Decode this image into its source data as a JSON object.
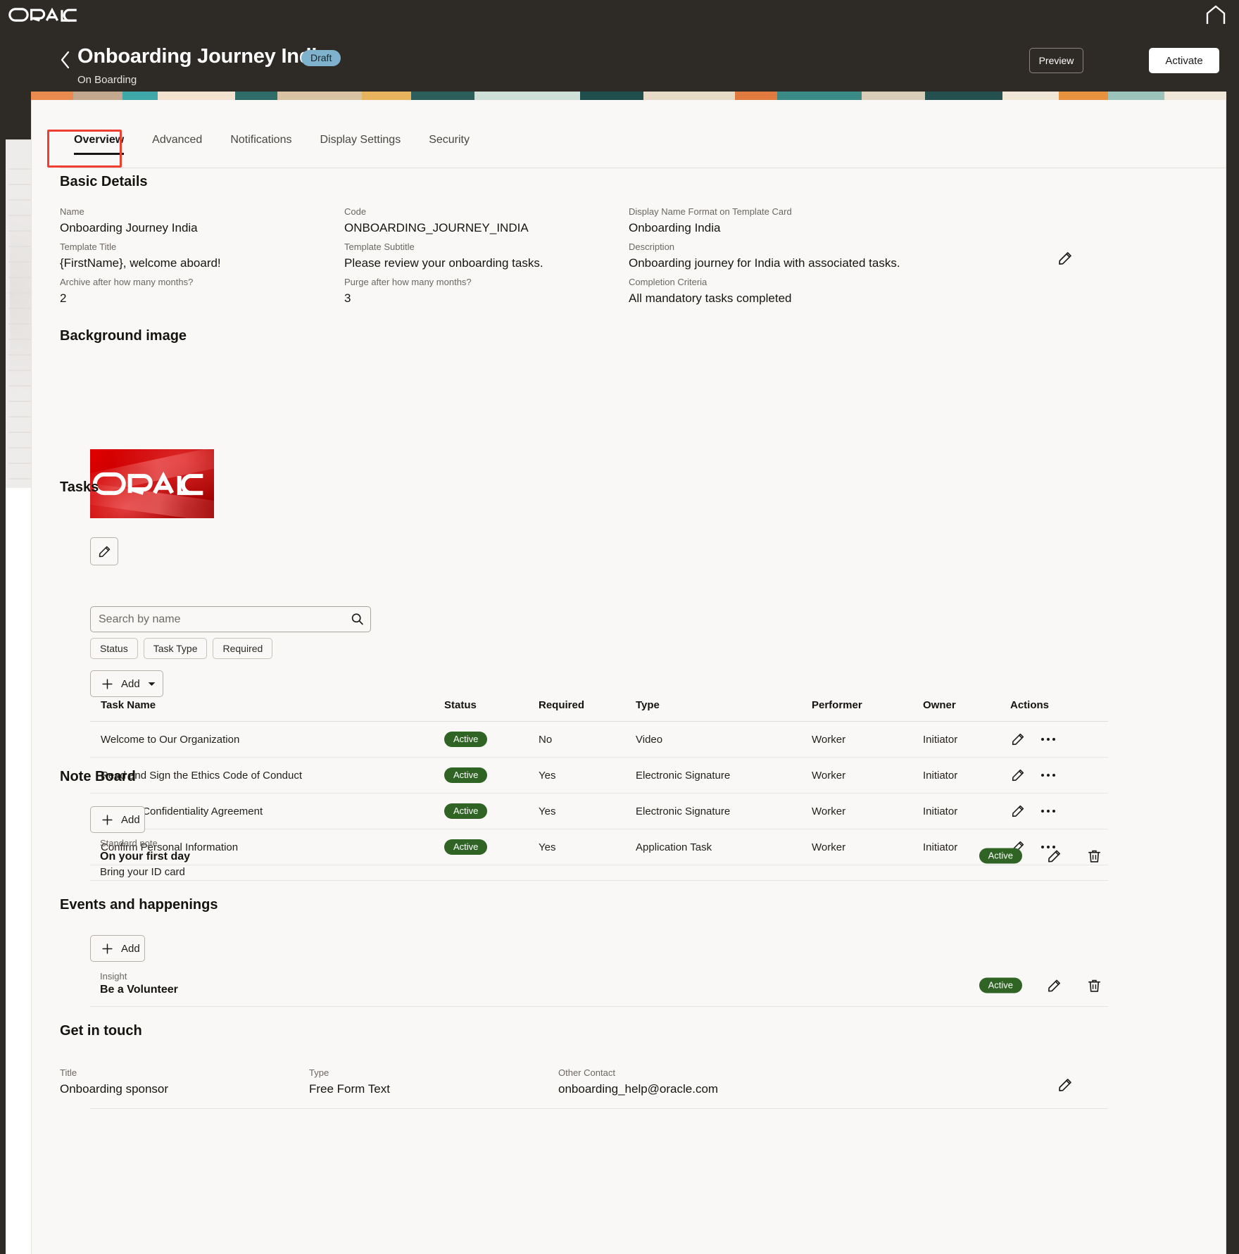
{
  "global": {
    "brand": "ORACLE",
    "home_icon": "home-icon"
  },
  "header": {
    "back_icon": "chevron-left-icon",
    "title": "Onboarding Journey India",
    "status_badge": "Draft",
    "subtitle": "On Boarding",
    "preview_label": "Preview",
    "activate_label": "Activate"
  },
  "tabs": [
    {
      "label": "Overview",
      "active": true
    },
    {
      "label": "Advanced",
      "active": false
    },
    {
      "label": "Notifications",
      "active": false
    },
    {
      "label": "Display Settings",
      "active": false
    },
    {
      "label": "Security",
      "active": false
    }
  ],
  "basic_details": {
    "heading": "Basic Details",
    "fields": [
      {
        "label": "Name",
        "value": "Onboarding Journey India"
      },
      {
        "label": "Code",
        "value": "ONBOARDING_JOURNEY_INDIA"
      },
      {
        "label": "Display Name Format on Template Card",
        "value": "Onboarding India"
      },
      {
        "label": "Template Title",
        "value": "{FirstName}, welcome aboard!"
      },
      {
        "label": "Template Subtitle",
        "value": "Please review your onboarding tasks."
      },
      {
        "label": "Description",
        "value": "Onboarding journey for India with associated tasks."
      },
      {
        "label": "Archive after how many months?",
        "value": "2"
      },
      {
        "label": "Purge after how many months?",
        "value": "3"
      },
      {
        "label": "Completion Criteria",
        "value": "All mandatory tasks completed"
      }
    ],
    "edit_icon": "pencil-icon"
  },
  "background_image": {
    "heading": "Background image",
    "image_alt": "ORACLE",
    "edit_icon": "pencil-icon"
  },
  "tasks": {
    "heading": "Tasks",
    "search_placeholder": "Search by name",
    "search_value": "",
    "search_icon": "search-icon",
    "filters": [
      "Status",
      "Task Type",
      "Required"
    ],
    "add_label": "Add",
    "add_icon": "plus-icon",
    "add_caret_icon": "chevron-down-icon",
    "columns": [
      "Task Name",
      "Status",
      "Required",
      "Type",
      "Performer",
      "Owner",
      "Actions"
    ],
    "rows": [
      {
        "name": "Welcome to Our Organization",
        "status": "Active",
        "required": "No",
        "type": "Video",
        "performer": "Worker",
        "owner": "Initiator"
      },
      {
        "name": "Read and Sign the Ethics Code of Conduct",
        "status": "Active",
        "required": "Yes",
        "type": "Electronic Signature",
        "performer": "Worker",
        "owner": "Initiator"
      },
      {
        "name": "Sign the Confidentiality Agreement",
        "status": "Active",
        "required": "Yes",
        "type": "Electronic Signature",
        "performer": "Worker",
        "owner": "Initiator"
      },
      {
        "name": "Confirm Personal Information",
        "status": "Active",
        "required": "Yes",
        "type": "Application Task",
        "performer": "Worker",
        "owner": "Initiator"
      }
    ],
    "row_edit_icon": "pencil-icon",
    "row_more_icon": "more-options-icon"
  },
  "note_board": {
    "heading": "Note Board",
    "add_label": "Add",
    "add_icon": "plus-icon",
    "items": [
      {
        "eyebrow": "Standard note",
        "title": "On your first day",
        "subtitle": "Bring your ID card",
        "status": "Active"
      }
    ],
    "edit_icon": "pencil-icon",
    "delete_icon": "trash-icon"
  },
  "events": {
    "heading": "Events and happenings",
    "add_label": "Add",
    "add_icon": "plus-icon",
    "items": [
      {
        "eyebrow": "Insight",
        "title": "Be a Volunteer",
        "status": "Active"
      }
    ],
    "edit_icon": "pencil-icon",
    "delete_icon": "trash-icon"
  },
  "get_in_touch": {
    "heading": "Get in touch",
    "fields": [
      {
        "label": "Title",
        "value": "Onboarding sponsor"
      },
      {
        "label": "Type",
        "value": "Free Form Text"
      },
      {
        "label": "Other Contact",
        "value": "onboarding_help@oracle.com"
      }
    ],
    "edit_icon": "pencil-icon"
  },
  "colors": {
    "header_bg": "#2e2a26",
    "content_bg": "#f9f8f6",
    "draft_badge": "#7fb2cc",
    "active_pill": "#2f6425",
    "highlight": "#ef3f33",
    "brand_red": "#c00000"
  }
}
